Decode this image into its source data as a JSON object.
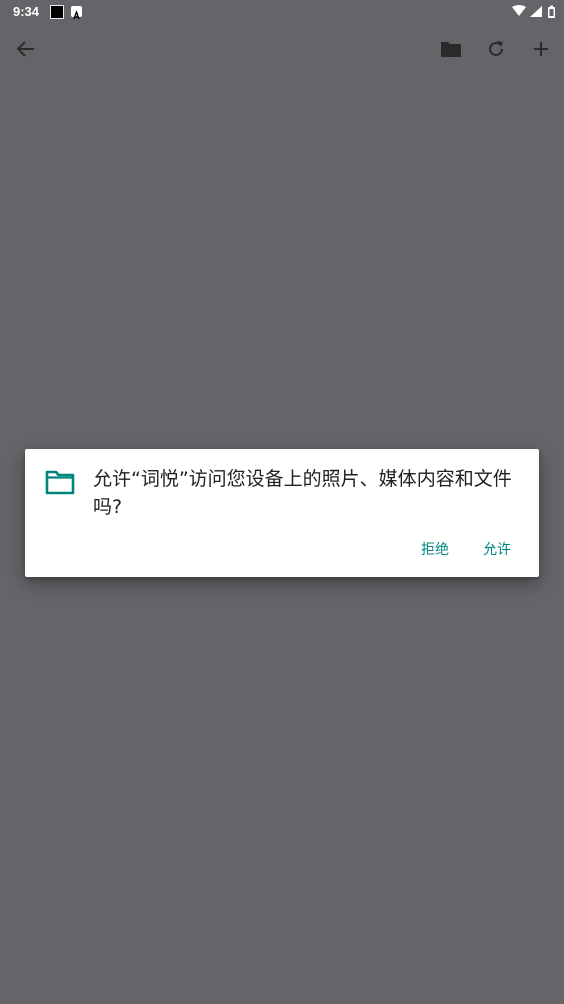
{
  "status_bar": {
    "time": "9:34",
    "icons": [
      "notification-square-icon",
      "app-a-icon",
      "wifi-icon",
      "signal-icon",
      "battery-icon"
    ]
  },
  "app_bar": {
    "icons": [
      "back-arrow-icon",
      "folder-icon",
      "refresh-icon",
      "add-icon"
    ]
  },
  "dialog": {
    "icon": "folder-outline-icon",
    "message": "允许“词悦”访问您设备上的照片、媒体内容和文件吗?",
    "deny_label": "拒绝",
    "allow_label": "允许",
    "accent_color": "#00857a"
  },
  "colors": {
    "scrim_background": "#666468",
    "dialog_background": "#ffffff"
  }
}
